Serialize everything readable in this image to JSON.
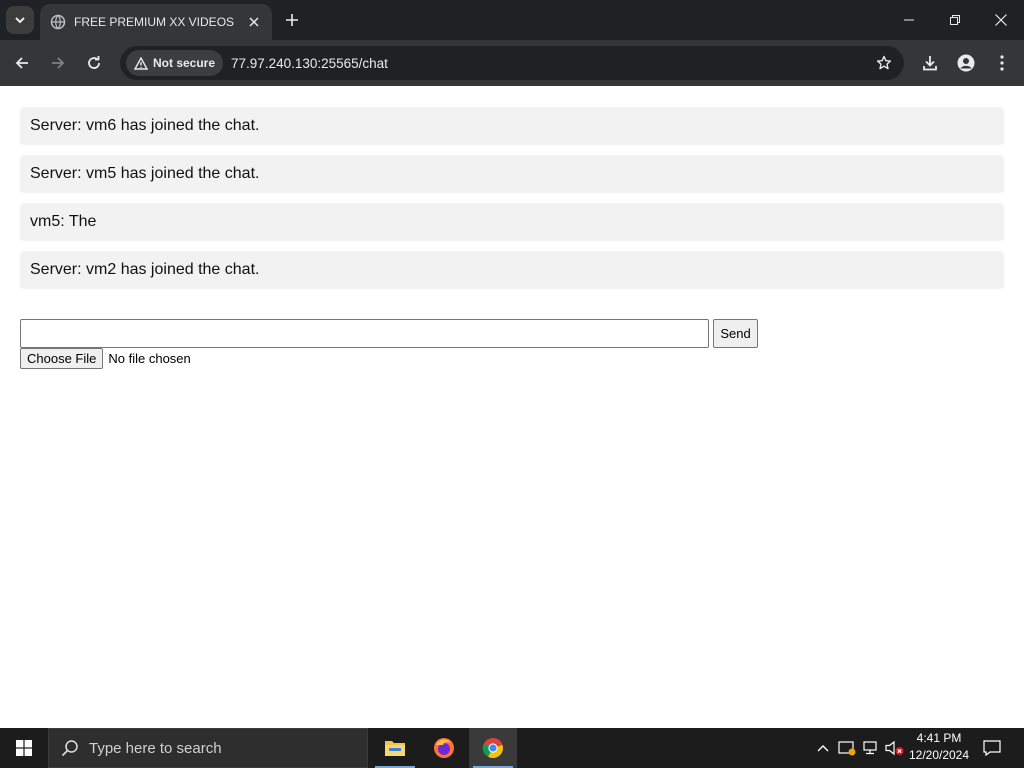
{
  "browser": {
    "tab_title": "FREE PREMIUM XX VIDEOS",
    "security_label": "Not secure",
    "url": "77.97.240.130:25565/chat"
  },
  "chat": {
    "messages": [
      "Server: vm6 has joined the chat.",
      "Server: vm5 has joined the chat.",
      "vm5: The",
      "Server: vm2 has joined the chat."
    ],
    "input_value": "",
    "send_label": "Send",
    "file_button_label": "Choose File",
    "file_status": "No file chosen"
  },
  "taskbar": {
    "search_placeholder": "Type here to search",
    "time": "4:41 PM",
    "date": "12/20/2024",
    "apps": [
      "file-explorer",
      "firefox",
      "chrome"
    ]
  },
  "colors": {
    "chrome_dark": "#202124",
    "chrome_toolbar": "#35363a",
    "message_bg": "#f2f2f2",
    "taskbar_bg": "#1c1c1c"
  }
}
